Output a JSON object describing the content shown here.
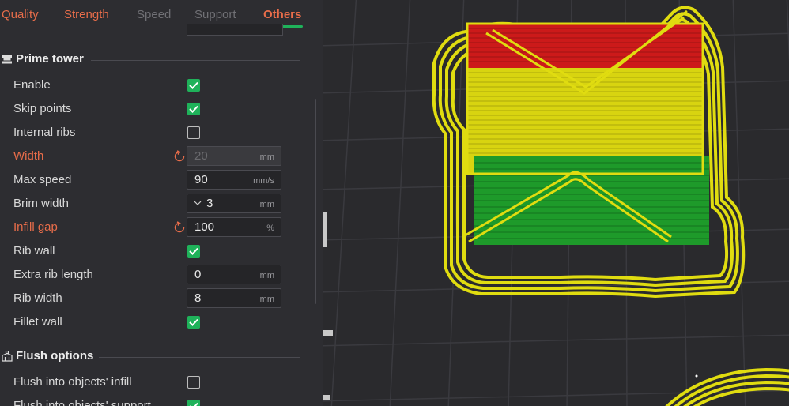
{
  "tabs": {
    "quality": "Quality",
    "strength": "Strength",
    "speed": "Speed",
    "support": "Support",
    "others": "Others"
  },
  "prime_tower": {
    "title": "Prime tower",
    "enable": {
      "label": "Enable",
      "checked": true
    },
    "skip_points": {
      "label": "Skip points",
      "checked": true
    },
    "internal_ribs": {
      "label": "Internal ribs",
      "checked": false
    },
    "width": {
      "label": "Width",
      "value": "20",
      "unit": "mm",
      "modified": true,
      "disabled": true
    },
    "max_speed": {
      "label": "Max speed",
      "value": "90",
      "unit": "mm/s"
    },
    "brim_width": {
      "label": "Brim width",
      "value": "3",
      "unit": "mm"
    },
    "infill_gap": {
      "label": "Infill gap",
      "value": "100",
      "unit": "%",
      "modified": true
    },
    "rib_wall": {
      "label": "Rib wall",
      "checked": true
    },
    "extra_rib_length": {
      "label": "Extra rib length",
      "value": "0",
      "unit": "mm"
    },
    "rib_width": {
      "label": "Rib width",
      "value": "8",
      "unit": "mm"
    },
    "fillet_wall": {
      "label": "Fillet wall",
      "checked": true
    }
  },
  "flush_options": {
    "title": "Flush options",
    "flush_infill": {
      "label": "Flush into objects' infill",
      "checked": false
    },
    "flush_support": {
      "label": "Flush into objects' support",
      "checked": true
    }
  },
  "colors": {
    "accent_green": "#1fb25a",
    "modified_orange": "#e86d4a",
    "tower_yellow": "#e0dc10",
    "tower_red": "#cc1a1a",
    "tower_green": "#1e9a2a"
  },
  "icons": {
    "prime_tower": "prime-tower-icon",
    "flush": "flush-icon",
    "reset": "reset-arrow-icon",
    "combo": "chevron-down-icon",
    "check": "check-icon"
  }
}
